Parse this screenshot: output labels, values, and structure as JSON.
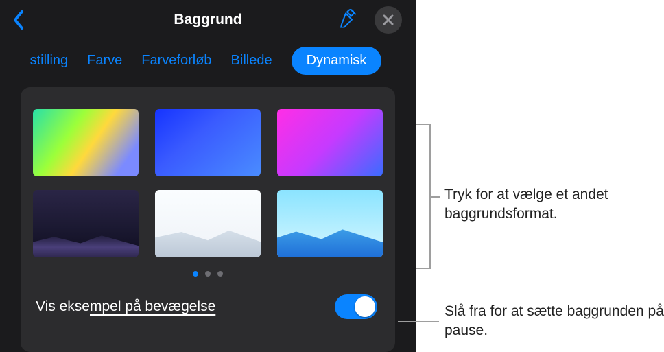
{
  "header": {
    "title": "Baggrund"
  },
  "tabs": {
    "items": [
      {
        "label": "stilling",
        "active": false,
        "partial": true
      },
      {
        "label": "Farve",
        "active": false
      },
      {
        "label": "Farveforløb",
        "active": false
      },
      {
        "label": "Billede",
        "active": false
      },
      {
        "label": "Dynamisk",
        "active": true
      }
    ]
  },
  "thumbnails": {
    "count": 6
  },
  "pager": {
    "total": 3,
    "active_index": 0
  },
  "toggle": {
    "label_prefix": "Vis ekse",
    "label_underlined": "mpel på bevægelse",
    "on": true
  },
  "callouts": {
    "select_format": "Tryk for at vælge et andet baggrundsformat.",
    "pause_background": "Slå fra for at sætte baggrunden på pause."
  },
  "icons": {
    "back": "chevron-left",
    "eyedropper": "eyedropper",
    "close": "xmark"
  }
}
